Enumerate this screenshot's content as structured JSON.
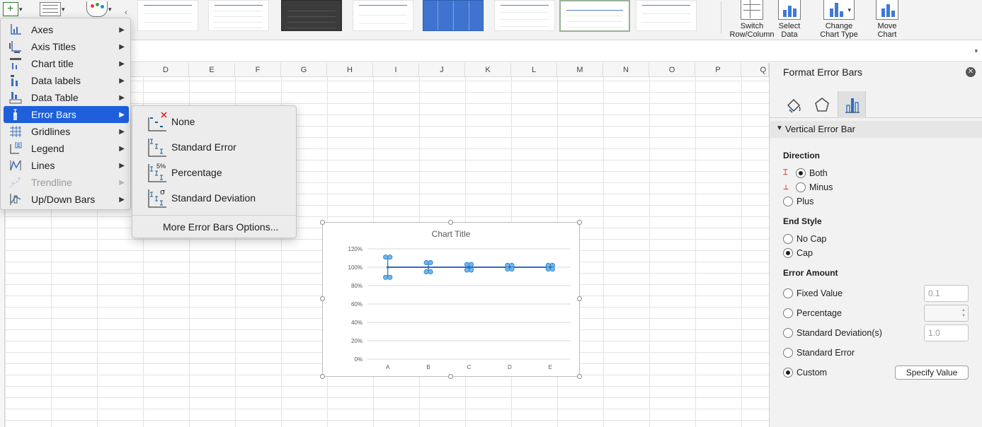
{
  "ribbon": {
    "tools": [
      {
        "label_line1": "Switch",
        "label_line2": "Row/Column"
      },
      {
        "label_line1": "Select",
        "label_line2": "Data"
      },
      {
        "label_line1": "Change",
        "label_line2": "Chart Type"
      },
      {
        "label_line1": "Move",
        "label_line2": "Chart"
      }
    ]
  },
  "grid": {
    "columns": [
      "D",
      "E",
      "F",
      "G",
      "H",
      "I",
      "J",
      "K",
      "L",
      "M",
      "N",
      "O",
      "P",
      "Q"
    ]
  },
  "menu": {
    "items": [
      {
        "label": "Axes",
        "icon": "axes-icon"
      },
      {
        "label": "Axis Titles",
        "icon": "axis-titles-icon"
      },
      {
        "label": "Chart title",
        "icon": "chart-title-icon"
      },
      {
        "label": "Data labels",
        "icon": "data-labels-icon"
      },
      {
        "label": "Data Table",
        "icon": "data-table-icon"
      },
      {
        "label": "Error Bars",
        "icon": "error-bars-icon",
        "active": true
      },
      {
        "label": "Gridlines",
        "icon": "gridlines-icon"
      },
      {
        "label": "Legend",
        "icon": "legend-icon"
      },
      {
        "label": "Lines",
        "icon": "lines-icon"
      },
      {
        "label": "Trendline",
        "icon": "trendline-icon",
        "disabled": true
      },
      {
        "label": "Up/Down Bars",
        "icon": "up-down-bars-icon"
      }
    ]
  },
  "submenu": {
    "items": [
      {
        "label": "None",
        "icon": "error-bars-none-icon"
      },
      {
        "label": "Standard Error",
        "icon": "standard-error-icon"
      },
      {
        "label": "Percentage",
        "icon": "percentage-icon",
        "badge": "5%"
      },
      {
        "label": "Standard Deviation",
        "icon": "standard-deviation-icon",
        "badge": "σ"
      }
    ],
    "more": "More Error Bars Options..."
  },
  "chart_data": {
    "type": "line",
    "title": "Chart Title",
    "categories": [
      "A",
      "B",
      "C",
      "D",
      "E"
    ],
    "series": [
      {
        "values": [
          1.0,
          1.0,
          1.0,
          1.0,
          1.0
        ]
      }
    ],
    "error_bars": {
      "plus": [
        0.11,
        0.05,
        0.03,
        0.02,
        0.02
      ],
      "minus": [
        0.11,
        0.05,
        0.03,
        0.02,
        0.02
      ]
    },
    "yticks": [
      "0%",
      "20%",
      "40%",
      "60%",
      "80%",
      "100%",
      "120%"
    ],
    "ylim": [
      0,
      1.2
    ],
    "grid": true,
    "series_color": "#2e6cc0",
    "marker_color": "#6fb6ee"
  },
  "pane": {
    "title": "Format Error Bars",
    "section": "Vertical Error Bar",
    "direction": {
      "label": "Direction",
      "options": [
        {
          "label": "Both",
          "selected": true
        },
        {
          "label": "Minus",
          "selected": false
        },
        {
          "label": "Plus",
          "selected": false
        }
      ]
    },
    "end_style": {
      "label": "End Style",
      "options": [
        {
          "label": "No Cap",
          "selected": false
        },
        {
          "label": "Cap",
          "selected": true
        }
      ]
    },
    "error_amount": {
      "label": "Error Amount",
      "options": [
        {
          "label": "Fixed Value",
          "selected": false,
          "value": "0.1"
        },
        {
          "label": "Percentage",
          "selected": false,
          "value": ""
        },
        {
          "label": "Standard Deviation(s)",
          "selected": false,
          "value": "1.0"
        },
        {
          "label": "Standard Error",
          "selected": false
        },
        {
          "label": "Custom",
          "selected": true
        }
      ],
      "specify_button": "Specify Value"
    }
  }
}
